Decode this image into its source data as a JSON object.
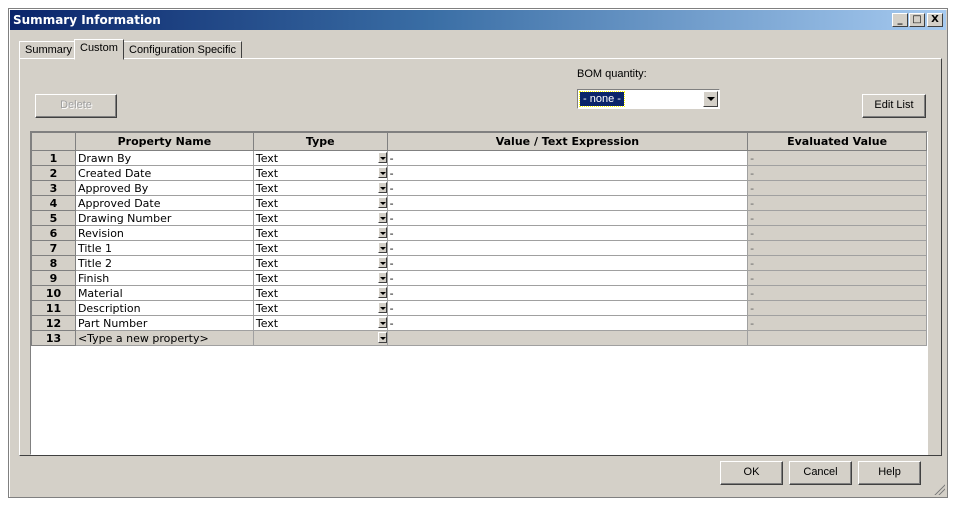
{
  "window": {
    "title": "Summary Information",
    "controls": {
      "minimize": "_",
      "maximize": "□",
      "close": "X"
    }
  },
  "tabs": [
    {
      "label": "Summary"
    },
    {
      "label": "Custom",
      "active": true
    },
    {
      "label": "Configuration Specific"
    }
  ],
  "toolbar": {
    "delete_label": "Delete",
    "bom_label": "BOM quantity:",
    "bom_value": "- none -",
    "edit_list_label": "Edit List"
  },
  "grid": {
    "headers": [
      "Property Name",
      "Type",
      "Value / Text Expression",
      "Evaluated Value"
    ],
    "rows": [
      {
        "num": "1",
        "name": "Drawn By",
        "type": "Text",
        "value": "-",
        "evaluated": "-"
      },
      {
        "num": "2",
        "name": "Created Date",
        "type": "Text",
        "value": "-",
        "evaluated": "-"
      },
      {
        "num": "3",
        "name": "Approved By",
        "type": "Text",
        "value": "-",
        "evaluated": "-"
      },
      {
        "num": "4",
        "name": "Approved Date",
        "type": "Text",
        "value": "-",
        "evaluated": "-"
      },
      {
        "num": "5",
        "name": "Drawing Number",
        "type": "Text",
        "value": "-",
        "evaluated": "-"
      },
      {
        "num": "6",
        "name": "Revision",
        "type": "Text",
        "value": "-",
        "evaluated": "-"
      },
      {
        "num": "7",
        "name": "Title 1",
        "type": "Text",
        "value": "-",
        "evaluated": "-"
      },
      {
        "num": "8",
        "name": "Title 2",
        "type": "Text",
        "value": "-",
        "evaluated": "-"
      },
      {
        "num": "9",
        "name": "Finish",
        "type": "Text",
        "value": "-",
        "evaluated": "-"
      },
      {
        "num": "10",
        "name": "Material",
        "type": "Text",
        "value": "-",
        "evaluated": "-"
      },
      {
        "num": "11",
        "name": "Description",
        "type": "Text",
        "value": "-",
        "evaluated": "-"
      },
      {
        "num": "12",
        "name": "Part Number",
        "type": "Text",
        "value": "-",
        "evaluated": "-"
      },
      {
        "num": "13",
        "name": "<Type a new property>",
        "type": "",
        "value": "",
        "evaluated": "",
        "new": true
      }
    ]
  },
  "footer": {
    "ok_label": "OK",
    "cancel_label": "Cancel",
    "help_label": "Help"
  }
}
